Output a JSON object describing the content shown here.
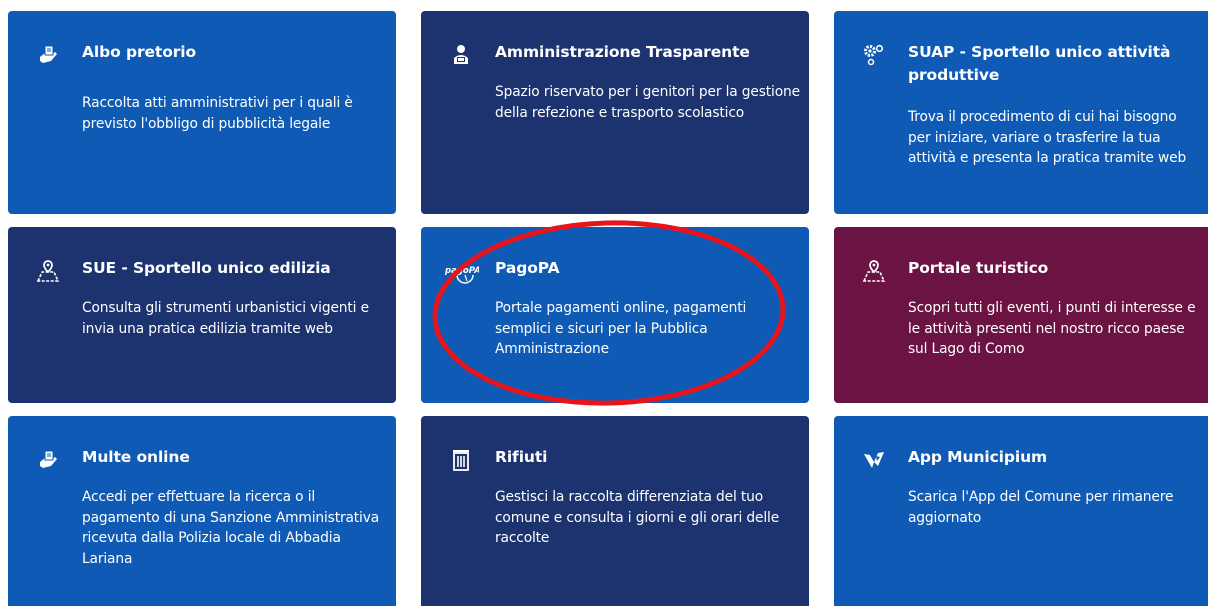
{
  "colors": {
    "blue": "#0f5ab4",
    "navy": "#1c3370",
    "maroon": "#6b1342",
    "highlight": "#e8141c"
  },
  "tiles": [
    {
      "title": "Albo pretorio",
      "description": "Raccolta atti amministrativi per i quali è previsto l'obbligo di pubblicità legale",
      "icon": "hand-document-icon"
    },
    {
      "title": "Amministrazione Trasparente",
      "description": "Spazio riservato per i genitori per la gestione della refezione e trasporto scolastico",
      "icon": "person-laptop-icon"
    },
    {
      "title": "SUAP - Sportello unico attività produttive",
      "description": "Trova il procedimento di cui hai bisogno per iniziare, variare o trasferire la tua attività e presenta la pratica tramite web",
      "icon": "gears-icon"
    },
    {
      "title": "SUE - Sportello unico edilizia",
      "description": "Consulta gli strumenti urbanistici vigenti e invia una pratica edilizia tramite web",
      "icon": "map-pin-icon"
    },
    {
      "title": "PagoPA",
      "description": "Portale pagamenti online, pagamenti semplici e sicuri per la Pubblica Amministrazione",
      "icon": "pagopa-logo-icon",
      "logo_text": "pagoPA"
    },
    {
      "title": "Portale turistico",
      "description": "Scopri tutti gli eventi, i punti di interesse e le attività presenti nel nostro ricco paese sul Lago di Como",
      "icon": "map-pin-icon"
    },
    {
      "title": "Multe online",
      "description": "Accedi per effettuare la ricerca o il pagamento di una Sanzione Amministrativa ricevuta dalla Polizia locale di Abbadia Lariana",
      "icon": "hand-document-icon"
    },
    {
      "title": "Rifiuti",
      "description": "Gestisci la raccolta differenziata del tuo comune e consulta i giorni e gli orari delle raccolte",
      "icon": "trash-bin-icon"
    },
    {
      "title": "App Municipium",
      "description": "Scarica l'App del Comune per rimanere aggiornato",
      "icon": "municipium-logo-icon"
    }
  ]
}
